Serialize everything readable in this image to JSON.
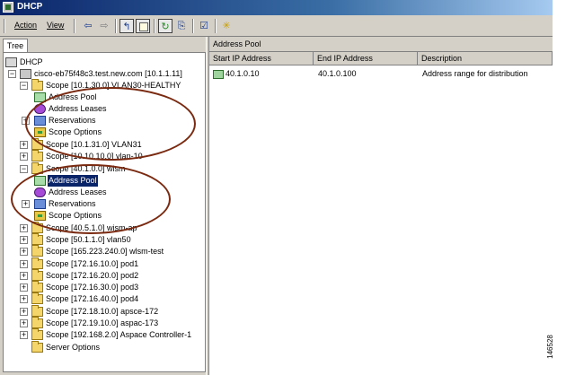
{
  "window": {
    "title": "DHCP"
  },
  "menu": {
    "action": "Action",
    "view": "View"
  },
  "toolbar": {
    "icons": [
      "back-arrow-icon",
      "forward-arrow-icon",
      "up-level-icon",
      "show-hide-tree-icon",
      "refresh-icon",
      "export-list-icon",
      "properties-icon",
      "new-scope-icon"
    ]
  },
  "tree": {
    "tab_label": "Tree",
    "root_label": "DHCP",
    "server_label": "cisco-eb75f48c3.test.new.com [10.1.1.11]",
    "scope1": {
      "label": "Scope [10.1.30.0] VLAN30-HEALTHY",
      "children": [
        "Address Pool",
        "Address Leases",
        "Reservations",
        "Scope Options"
      ]
    },
    "scope2_label": "Scope [10.1.31.0] VLAN31",
    "scope3_label": "Scope [10.10.10.0] vlan-10",
    "scope4": {
      "label": "Scope [40.1.0.0] wism",
      "children": [
        "Address Pool",
        "Address Leases",
        "Reservations",
        "Scope Options"
      ]
    },
    "more_scopes": [
      "Scope [40.5.1.0] wism-ap",
      "Scope [50.1.1.0] vlan50",
      "Scope [165.223.240.0] wlsm-test",
      "Scope [172.16.10.0] pod1",
      "Scope [172.16.20.0] pod2",
      "Scope [172.16.30.0] pod3",
      "Scope [172.16.40.0] pod4",
      "Scope [172.18.10.0] apsce-172",
      "Scope [172.19.10.0] aspac-173",
      "Scope [192.168.2.0] Aspace Controller-1"
    ],
    "server_options_label": "Server Options"
  },
  "details": {
    "header": "Address Pool",
    "columns": [
      "Start IP Address",
      "End IP Address",
      "Description"
    ],
    "rows": [
      {
        "start": "40.1.0.10",
        "end": "40.1.0.100",
        "description": "Address range for distribution"
      }
    ]
  },
  "figure_number": "146528",
  "colors": {
    "title_bar": "#0a246a",
    "selection": "#0a246a",
    "annotation_ellipse": "#7a2a10"
  }
}
